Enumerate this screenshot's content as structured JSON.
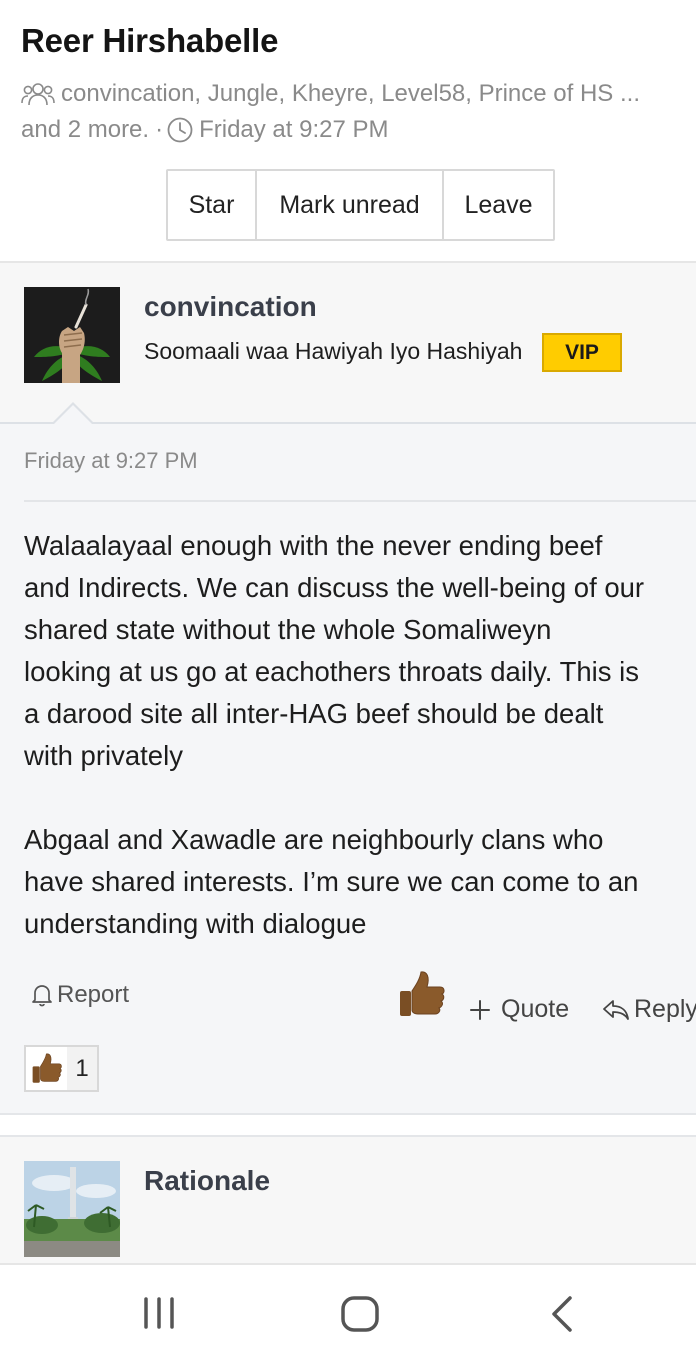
{
  "conversation": {
    "title": "Reer Hirshabelle",
    "participants": "convincation, Jungle, Kheyre, Level58, Prince of HS ...",
    "more": "and 2 more.",
    "separator": "·",
    "started": "Friday at 9:27 PM"
  },
  "actions": {
    "star": "Star",
    "mark_unread": "Mark unread",
    "leave": "Leave"
  },
  "messages": [
    {
      "username": "convincation",
      "user_title": "Soomaali waa Hawiyah Iyo Hashiyah",
      "badge": "VIP",
      "date": "Friday at 9:27 PM",
      "body_lines": [
        "Walaalayaal enough with the never ending beef",
        "and Indirects. We can discuss the well-being of our",
        "shared state without the whole Somaliweyn",
        "looking at us go at eachothers throats daily. This is",
        "a darood site all inter-HAG beef should be dealt",
        "with privately"
      ],
      "body_lines_2": [
        "Abgaal and Xawadle are neighbourly clans who",
        "have shared interests. I’m sure we can come to an",
        "understanding with dialogue"
      ],
      "report_label": "Report",
      "quote_label": "Quote",
      "reply_label": "Reply",
      "reaction_count": "1"
    },
    {
      "username": "Rationale"
    }
  ],
  "colors": {
    "vip_badge": "#ffcc00",
    "username": "#3a3f4a",
    "meta_text": "#8a8a8a",
    "thumb_skin": "#8a5a2b"
  },
  "icons": {
    "participants": "people-icon",
    "started": "clock-icon",
    "report": "bell-icon",
    "like": "thumbs-up-icon",
    "quote": "plus-icon",
    "reply": "reply-arrow-icon",
    "nav": [
      "recent-apps-icon",
      "home-icon",
      "back-icon"
    ]
  }
}
